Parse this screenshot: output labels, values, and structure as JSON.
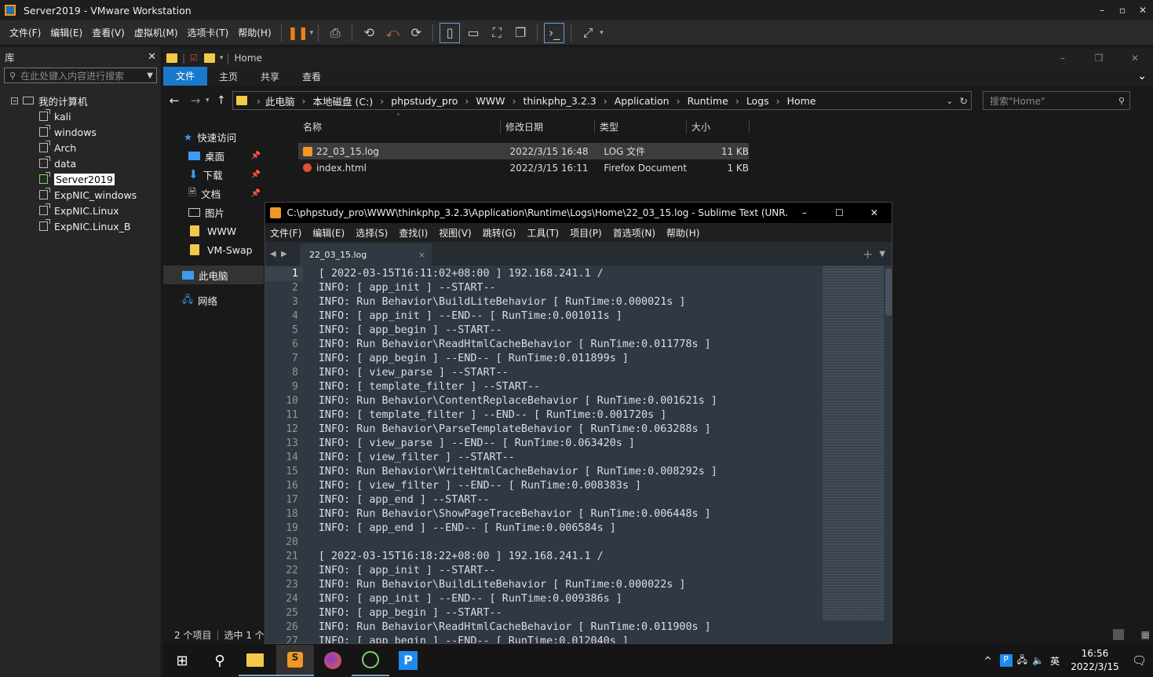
{
  "vmware": {
    "title": "Server2019 - VMware Workstation",
    "menu": [
      "文件(F)",
      "编辑(E)",
      "查看(V)",
      "虚拟机(M)",
      "选项卡(T)",
      "帮助(H)"
    ],
    "library_title": "库",
    "library_search_placeholder": "在此处键入内容进行搜索",
    "tree_root": "我的计算机",
    "tree_items": [
      "kali",
      "windows",
      "Arch",
      "data",
      "Server2019",
      "ExpNIC_windows",
      "ExpNIC.Linux",
      "ExpNIC.Linux_B"
    ]
  },
  "explorer": {
    "title": "Home",
    "ribbon_tabs": [
      "文件",
      "主页",
      "共享",
      "查看"
    ],
    "breadcrumb": [
      "此电脑",
      "本地磁盘 (C:)",
      "phpstudy_pro",
      "WWW",
      "thinkphp_3.2.3",
      "Application",
      "Runtime",
      "Logs",
      "Home"
    ],
    "search_placeholder": "搜索\"Home\"",
    "quick_access": "快速访问",
    "sidebar": [
      "桌面",
      "下载",
      "文档",
      "图片",
      "WWW",
      "VM-Swap"
    ],
    "this_pc": "此电脑",
    "network": "网络",
    "columns": [
      "名称",
      "修改日期",
      "类型",
      "大小"
    ],
    "files": [
      {
        "name": "22_03_15.log",
        "date": "2022/3/15 16:48",
        "type": "LOG 文件",
        "size": "11 KB"
      },
      {
        "name": "index.html",
        "date": "2022/3/15 16:11",
        "type": "Firefox Document",
        "size": "1 KB"
      }
    ],
    "status_count": "2 个项目",
    "status_selected": "选中 1 个"
  },
  "sublime": {
    "title": "C:\\phpstudy_pro\\WWW\\thinkphp_3.2.3\\Application\\Runtime\\Logs\\Home\\22_03_15.log - Sublime Text (UNR...",
    "menu": [
      "文件(F)",
      "编辑(E)",
      "选择(S)",
      "查找(I)",
      "视图(V)",
      "跳转(G)",
      "工具(T)",
      "项目(P)",
      "首选项(N)",
      "帮助(H)"
    ],
    "tab": "22_03_15.log",
    "lines": [
      "[ 2022-03-15T16:11:02+08:00 ] 192.168.241.1 /",
      "INFO: [ app_init ] --START--",
      "INFO: Run Behavior\\BuildLiteBehavior [ RunTime:0.000021s ]",
      "INFO: [ app_init ] --END-- [ RunTime:0.001011s ]",
      "INFO: [ app_begin ] --START--",
      "INFO: Run Behavior\\ReadHtmlCacheBehavior [ RunTime:0.011778s ]",
      "INFO: [ app_begin ] --END-- [ RunTime:0.011899s ]",
      "INFO: [ view_parse ] --START--",
      "INFO: [ template_filter ] --START--",
      "INFO: Run Behavior\\ContentReplaceBehavior [ RunTime:0.001621s ]",
      "INFO: [ template_filter ] --END-- [ RunTime:0.001720s ]",
      "INFO: Run Behavior\\ParseTemplateBehavior [ RunTime:0.063288s ]",
      "INFO: [ view_parse ] --END-- [ RunTime:0.063420s ]",
      "INFO: [ view_filter ] --START--",
      "INFO: Run Behavior\\WriteHtmlCacheBehavior [ RunTime:0.008292s ]",
      "INFO: [ view_filter ] --END-- [ RunTime:0.008383s ]",
      "INFO: [ app_end ] --START--",
      "INFO: Run Behavior\\ShowPageTraceBehavior [ RunTime:0.006448s ]",
      "INFO: [ app_end ] --END-- [ RunTime:0.006584s ]",
      "",
      "[ 2022-03-15T16:18:22+08:00 ] 192.168.241.1 /",
      "INFO: [ app_init ] --START--",
      "INFO: Run Behavior\\BuildLiteBehavior [ RunTime:0.000022s ]",
      "INFO: [ app_init ] --END-- [ RunTime:0.009386s ]",
      "INFO: [ app_begin ] --START--",
      "INFO: Run Behavior\\ReadHtmlCacheBehavior [ RunTime:0.011900s ]",
      "INFO: [ app_begin ] --END-- [ RunTime:0.012040s ]"
    ]
  },
  "taskbar": {
    "time": "16:56",
    "date": "2022/3/15",
    "ime": "英"
  }
}
